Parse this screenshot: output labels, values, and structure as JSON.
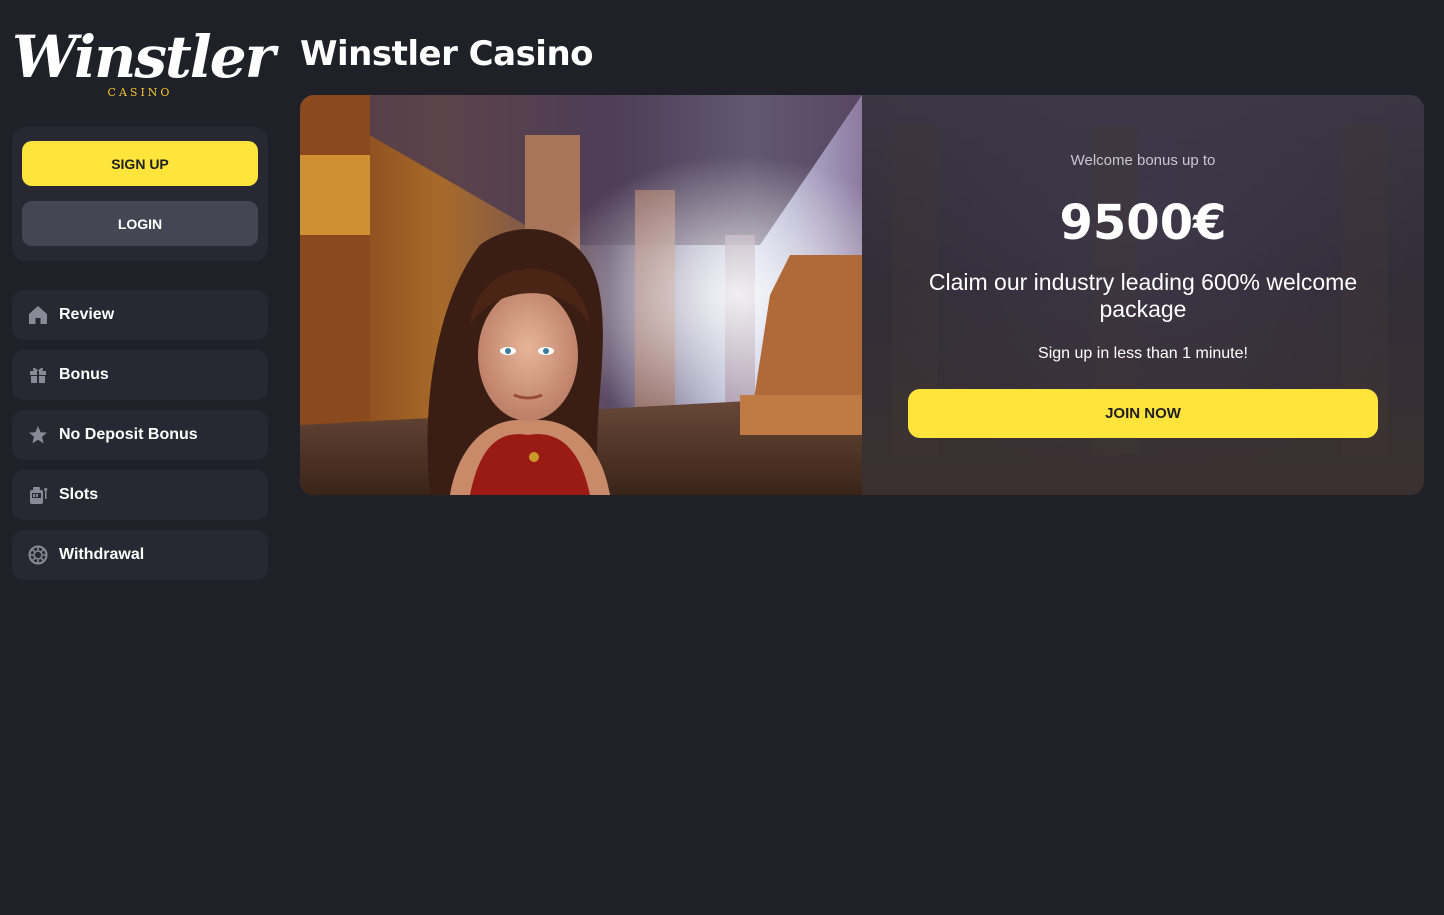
{
  "logo": {
    "wordmark": "Winstler",
    "subtext": "CASINO"
  },
  "auth": {
    "signup_label": "SIGN UP",
    "login_label": "LOGIN"
  },
  "nav": {
    "items": [
      {
        "label": "Review",
        "icon": "home-icon"
      },
      {
        "label": "Bonus",
        "icon": "gift-icon"
      },
      {
        "label": "No Deposit Bonus",
        "icon": "star-icon"
      },
      {
        "label": "Slots",
        "icon": "slot-machine-icon"
      },
      {
        "label": "Withdrawal",
        "icon": "chip-icon"
      }
    ]
  },
  "page": {
    "title": "Winstler Casino"
  },
  "hero": {
    "bonus_pre": "Welcome bonus up to",
    "bonus_amount": "9500€",
    "claim_text": "Claim our industry leading 600% welcome package",
    "signup_text": "Sign up in less than 1 minute!",
    "join_label": "JOIN NOW"
  },
  "colors": {
    "background": "#202029",
    "card": "#282833",
    "accent_yellow": "#ffe53b",
    "login_button": "#454654",
    "logo_gold": "#f0c832"
  }
}
